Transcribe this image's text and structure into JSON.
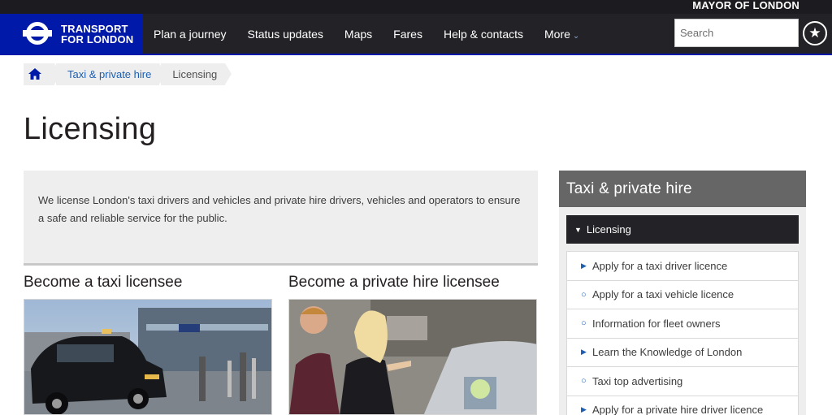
{
  "top_strip": {
    "mayor_label": "MAYOR OF LONDON"
  },
  "brand": {
    "line1": "TRANSPORT",
    "line2": "FOR LONDON"
  },
  "nav": {
    "items": [
      "Plan a journey",
      "Status updates",
      "Maps",
      "Fares",
      "Help & contacts",
      "More"
    ],
    "more_chevron": "⌄"
  },
  "search": {
    "placeholder": "Search"
  },
  "favourites_icon": "★",
  "breadcrumb": {
    "home_icon": "home-icon",
    "items": [
      "Taxi & private hire",
      "Licensing"
    ]
  },
  "page": {
    "title": "Licensing",
    "intro": "We license London's taxi drivers and vehicles and private hire drivers, vehicles and operators to ensure a safe and reliable service for the public."
  },
  "cards": [
    {
      "title": "Become a taxi licensee"
    },
    {
      "title": "Become a private hire licensee"
    }
  ],
  "sidebar": {
    "heading": "Taxi & private hire",
    "active": {
      "marker": "▼",
      "label": "Licensing"
    },
    "items": [
      {
        "marker": "▶",
        "label": "Apply for a taxi driver licence"
      },
      {
        "marker": "○",
        "label": "Apply for a taxi vehicle licence"
      },
      {
        "marker": "○",
        "label": "Information for fleet owners"
      },
      {
        "marker": "▶",
        "label": "Learn the Knowledge of London"
      },
      {
        "marker": "○",
        "label": "Taxi top advertising"
      },
      {
        "marker": "▶",
        "label": "Apply for a private hire driver licence"
      }
    ]
  },
  "colors": {
    "brand_blue": "#0019a8",
    "nav_bg": "#232327",
    "link": "#1e5fb0",
    "panel": "#eeeeee"
  }
}
